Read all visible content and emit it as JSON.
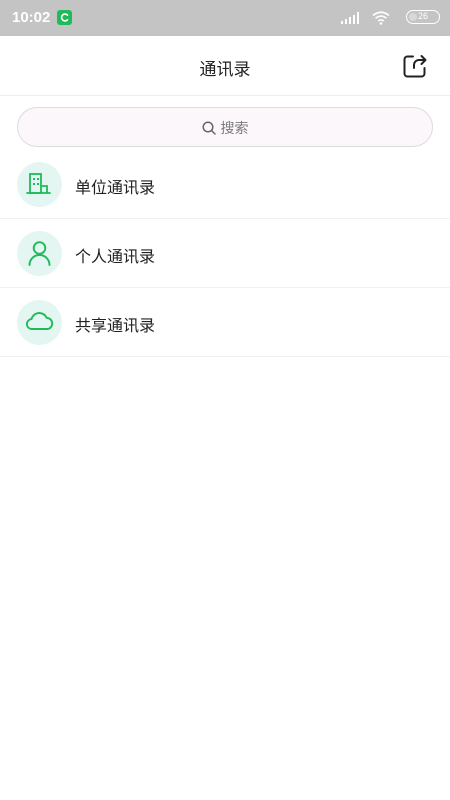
{
  "status_bar": {
    "time": "10:02",
    "battery": "26"
  },
  "header": {
    "title": "通讯录",
    "action_icon": "share-icon"
  },
  "search": {
    "placeholder": "搜索"
  },
  "contacts_menu": {
    "items": [
      {
        "label": "单位通讯录",
        "icon": "building-icon"
      },
      {
        "label": "个人通讯录",
        "icon": "person-icon"
      },
      {
        "label": "共享通讯录",
        "icon": "cloud-icon"
      }
    ]
  },
  "colors": {
    "accent": "#1fba5a",
    "icon_bg": "#e3f6f1",
    "status_bar_bg": "#c4c4c4"
  }
}
